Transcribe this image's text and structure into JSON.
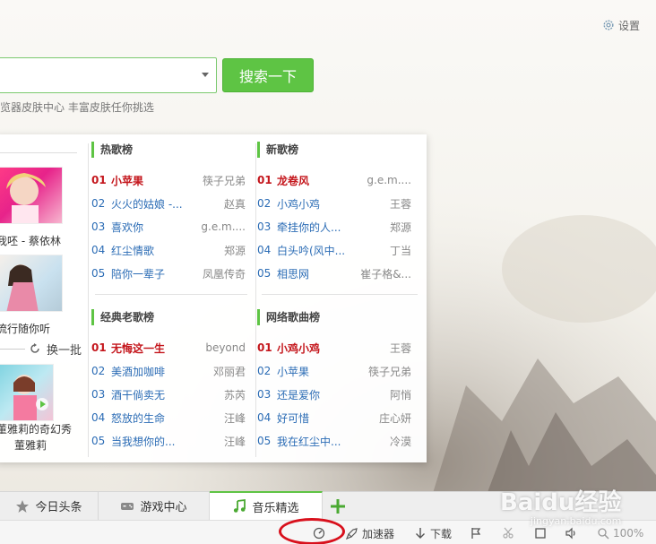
{
  "colors": {
    "accent": "#5ec444",
    "link": "#2b6cb5",
    "top_item": "#c4161c",
    "annotation": "#d8101c"
  },
  "settings": {
    "label": "设置",
    "icon": "gear-icon"
  },
  "search": {
    "value": "",
    "placeholder": "",
    "button_label": "搜索一下"
  },
  "hint_text": "览器皮肤中心 丰富皮肤任你挑选",
  "left_column": {
    "items": [
      {
        "caption": "我呸 - 蔡依林"
      },
      {
        "caption": "流行随你听"
      }
    ],
    "change_label": "换一批",
    "bottom_caption_1": "董雅莉的奇幻秀",
    "bottom_caption_2": "董雅莉"
  },
  "charts": {
    "hot": {
      "title": "热歌榜",
      "items": [
        {
          "num": "01",
          "title": "小苹果",
          "artist": "筷子兄弟"
        },
        {
          "num": "02",
          "title": "火火的姑娘 -...",
          "artist": "赵真"
        },
        {
          "num": "03",
          "title": "喜欢你",
          "artist": "g.e.m...."
        },
        {
          "num": "04",
          "title": "红尘情歌",
          "artist": "郑源"
        },
        {
          "num": "05",
          "title": "陪你一辈子",
          "artist": "凤凰传奇"
        }
      ]
    },
    "new": {
      "title": "新歌榜",
      "items": [
        {
          "num": "01",
          "title": "龙卷风",
          "artist": "g.e.m...."
        },
        {
          "num": "02",
          "title": "小鸡小鸡",
          "artist": "王蓉"
        },
        {
          "num": "03",
          "title": "牵挂你的人...",
          "artist": "郑源"
        },
        {
          "num": "04",
          "title": "白头吟(风中...",
          "artist": "丁当"
        },
        {
          "num": "05",
          "title": "相思网",
          "artist": "崔子格&..."
        }
      ]
    },
    "classic": {
      "title": "经典老歌榜",
      "items": [
        {
          "num": "01",
          "title": "无悔这一生",
          "artist": "beyond"
        },
        {
          "num": "02",
          "title": "美酒加咖啡",
          "artist": "邓丽君"
        },
        {
          "num": "03",
          "title": "酒干倘卖无",
          "artist": "苏芮"
        },
        {
          "num": "04",
          "title": "怒放的生命",
          "artist": "汪峰"
        },
        {
          "num": "05",
          "title": "当我想你的...",
          "artist": "汪峰"
        }
      ]
    },
    "network": {
      "title": "网络歌曲榜",
      "items": [
        {
          "num": "01",
          "title": "小鸡小鸡",
          "artist": "王蓉"
        },
        {
          "num": "02",
          "title": "小苹果",
          "artist": "筷子兄弟"
        },
        {
          "num": "03",
          "title": "还是爱你",
          "artist": "阿悄"
        },
        {
          "num": "04",
          "title": "好可惜",
          "artist": "庄心妍"
        },
        {
          "num": "05",
          "title": "我在红尘中...",
          "artist": "冷漠"
        }
      ]
    }
  },
  "tabs": [
    {
      "label": "今日头条",
      "icon": "star-icon"
    },
    {
      "label": "游戏中心",
      "icon": "gamepad-icon"
    },
    {
      "label": "音乐精选",
      "icon": "music-note-icon",
      "active": true
    }
  ],
  "statusbar": {
    "accelerator_label": "加速器",
    "download_label": "下载",
    "zoom_label": "100%"
  },
  "watermark": {
    "text": "Baidu经验",
    "url_text": "jingyan.baidu.com"
  }
}
